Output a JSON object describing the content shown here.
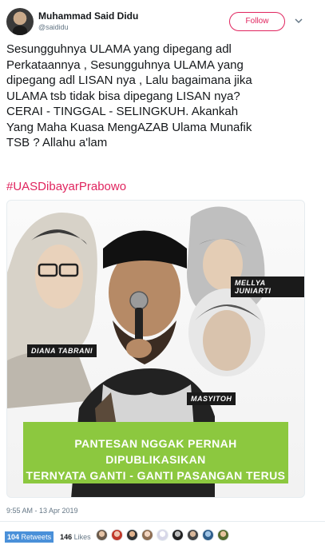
{
  "user": {
    "name": "Muhammad Said Didu",
    "handle": "@saididu",
    "follow_label": "Follow"
  },
  "tweet": {
    "text": "Sesungguhnya ULAMA yang dipegang adl\nPerkataannya , Sesungguhnya ULAMA yang\ndipegang adl LISAN nya , Lalu bagaimana jika\nULAMA tsb tidak bisa dipegang LISAN nya?\nCERAI - TINGGAL - SELINGKUH. Akankah\nYang Maha Kuasa MengAZAB Ulama Munafik\nTSB ? Allahu a'lam",
    "hashtag": "#UASDibayarPrabowo"
  },
  "media": {
    "labels": {
      "diana": "DIANA TABRANI",
      "mellya": "MELLYA JUNIARTI",
      "masyitoh": "MASYITOH"
    },
    "banner_line1": "PANTESAN NGGAK PERNAH DIPUBLIKASIKAN",
    "banner_line2": "TERNYATA GANTI - GANTI PASANGAN TERUS",
    "banner_color": "#8cc83f"
  },
  "footer": {
    "timestamp": "9:55 AM - 13 Apr 2019",
    "retweets_count": "104",
    "retweets_label": "Retweets",
    "likes_count": "146",
    "likes_label": "Likes",
    "retweet_highlight_color": "#4a90d9"
  },
  "colors": {
    "accent": "#e0245e",
    "text": "#14171a",
    "muted": "#657786"
  }
}
